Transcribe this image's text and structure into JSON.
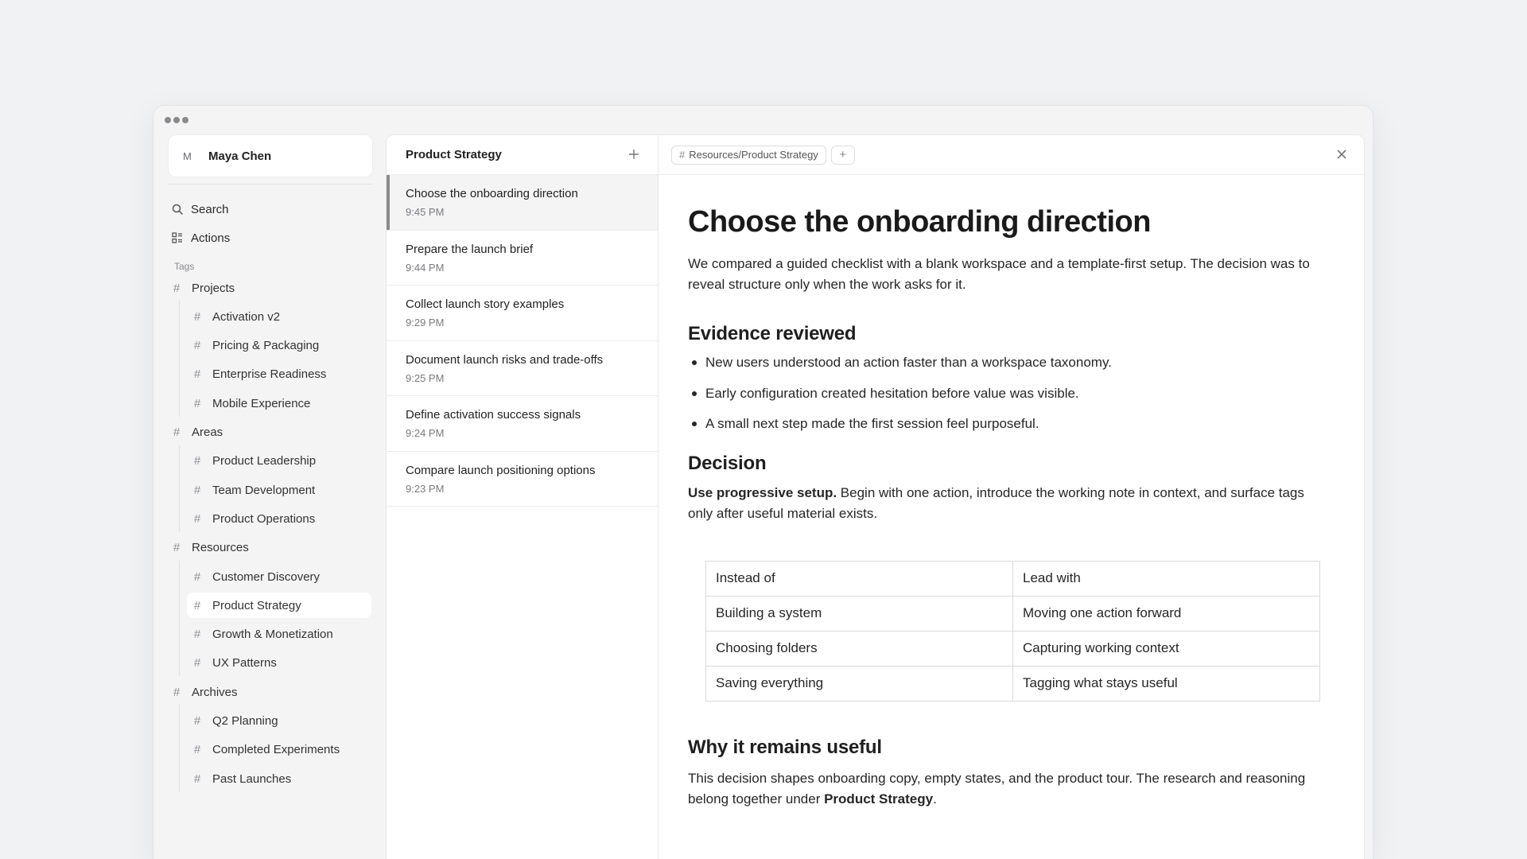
{
  "user": {
    "initial": "M",
    "name": "Maya Chen"
  },
  "sidebar": {
    "search": "Search",
    "actions": "Actions",
    "tags_label": "Tags",
    "groups": [
      {
        "label": "Projects",
        "children": [
          "Activation v2",
          "Pricing & Packaging",
          "Enterprise Readiness",
          "Mobile Experience"
        ]
      },
      {
        "label": "Areas",
        "children": [
          "Product Leadership",
          "Team Development",
          "Product Operations"
        ]
      },
      {
        "label": "Resources",
        "children": [
          "Customer Discovery",
          "Product Strategy",
          "Growth & Monetization",
          "UX Patterns"
        ]
      },
      {
        "label": "Archives",
        "children": [
          "Q2 Planning",
          "Completed Experiments",
          "Past Launches"
        ]
      }
    ],
    "selected": "Product Strategy"
  },
  "list": {
    "title": "Product Strategy",
    "notes": [
      {
        "title": "Choose the onboarding direction",
        "time": "9:45 PM"
      },
      {
        "title": "Prepare the launch brief",
        "time": "9:44 PM"
      },
      {
        "title": "Collect launch story examples",
        "time": "9:29 PM"
      },
      {
        "title": "Document launch risks and trade-offs",
        "time": "9:25 PM"
      },
      {
        "title": "Define activation success signals",
        "time": "9:24 PM"
      },
      {
        "title": "Compare launch positioning options",
        "time": "9:23 PM"
      }
    ]
  },
  "editor": {
    "breadcrumb": "Resources/Product Strategy",
    "title": "Choose the onboarding direction",
    "intro": "We compared a guided checklist with a blank workspace and a template-first setup. The decision was to reveal structure only when the work asks for it.",
    "evidence_heading": "Evidence reviewed",
    "evidence": [
      "New users understood an action faster than a workspace taxonomy.",
      "Early configuration created hesitation before value was visible.",
      "A small next step made the first session feel purposeful."
    ],
    "decision_heading": "Decision",
    "decision_bold": "Use progressive setup.",
    "decision_text": " Begin with one action, introduce the working note in context, and surface tags only after useful material exists.",
    "table": [
      [
        "Instead of",
        "Lead with"
      ],
      [
        "Building a system",
        "Moving one action forward"
      ],
      [
        "Choosing folders",
        "Capturing working context"
      ],
      [
        "Saving everything",
        "Tagging what stays useful"
      ]
    ],
    "why_heading": "Why it remains useful",
    "why_text": "This decision shapes onboarding copy, empty states, and the product tour. The research and reasoning belong together under ",
    "why_bold": "Product Strategy",
    "why_end": "."
  }
}
